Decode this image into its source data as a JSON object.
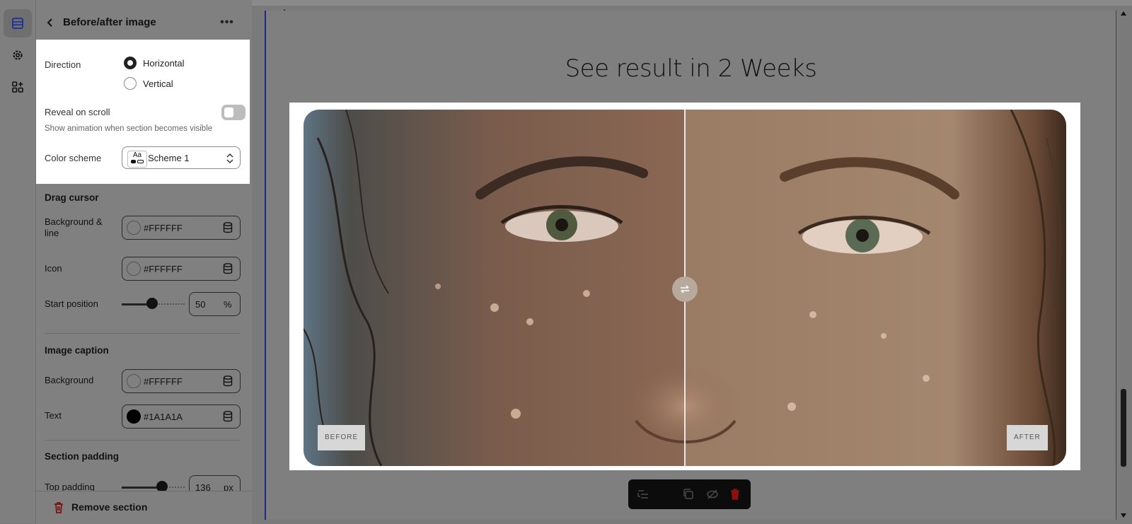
{
  "panel": {
    "title": "Before/after image",
    "direction": {
      "label": "Direction",
      "options": [
        "Horizontal",
        "Vertical"
      ],
      "selected": "Horizontal"
    },
    "reveal": {
      "label": "Reveal on scroll",
      "enabled": false,
      "help": "Show animation when section becomes visible"
    },
    "color_scheme": {
      "label": "Color scheme",
      "icon_text": "Aa",
      "value": "Scheme 1"
    },
    "drag_cursor": {
      "title": "Drag cursor",
      "background_label": "Background & line",
      "background_value": "#FFFFFF",
      "icon_label": "Icon",
      "icon_value": "#FFFFFF",
      "start_position_label": "Start position",
      "start_position_value": "50",
      "start_position_unit": "%"
    },
    "image_caption": {
      "title": "Image caption",
      "background_label": "Background",
      "background_value": "#FFFFFF",
      "text_label": "Text",
      "text_value": "#1A1A1A"
    },
    "section_padding": {
      "title": "Section padding",
      "top_label": "Top padding",
      "top_value": "136",
      "top_unit": "px"
    },
    "remove_label": "Remove section"
  },
  "preview": {
    "heading": "See result in 2 Weeks",
    "before_caption": "BEFORE",
    "after_caption": "AFTER",
    "slider_position": 0.5
  },
  "colors": {
    "accent_border": "#1b2a8a",
    "remove_red": "#c01818"
  }
}
